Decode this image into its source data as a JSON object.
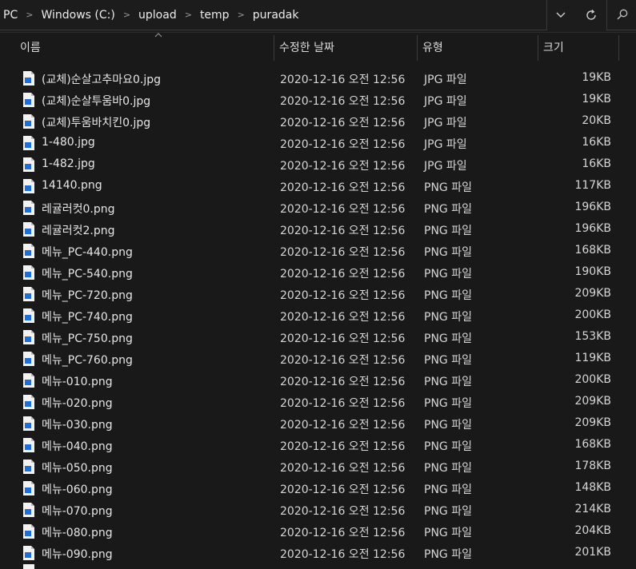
{
  "breadcrumb": [
    "PC",
    "Windows (C:)",
    "upload",
    "temp",
    "puradak"
  ],
  "columns": {
    "name": "이름",
    "date": "수정한 날짜",
    "type": "유형",
    "size": "크기"
  },
  "files": [
    {
      "name": "(교체)순살고추마요0.jpg",
      "date": "2020-12-16 오전 12:56",
      "type": "JPG 파일",
      "size": "19KB"
    },
    {
      "name": "(교체)순살투움바0.jpg",
      "date": "2020-12-16 오전 12:56",
      "type": "JPG 파일",
      "size": "19KB"
    },
    {
      "name": "(교체)투움바치킨0.jpg",
      "date": "2020-12-16 오전 12:56",
      "type": "JPG 파일",
      "size": "20KB"
    },
    {
      "name": "1-480.jpg",
      "date": "2020-12-16 오전 12:56",
      "type": "JPG 파일",
      "size": "16KB"
    },
    {
      "name": "1-482.jpg",
      "date": "2020-12-16 오전 12:56",
      "type": "JPG 파일",
      "size": "16KB"
    },
    {
      "name": "14140.png",
      "date": "2020-12-16 오전 12:56",
      "type": "PNG 파일",
      "size": "117KB"
    },
    {
      "name": "레귤러컷0.png",
      "date": "2020-12-16 오전 12:56",
      "type": "PNG 파일",
      "size": "196KB"
    },
    {
      "name": "레귤러컷2.png",
      "date": "2020-12-16 오전 12:56",
      "type": "PNG 파일",
      "size": "196KB"
    },
    {
      "name": "메뉴_PC-440.png",
      "date": "2020-12-16 오전 12:56",
      "type": "PNG 파일",
      "size": "168KB"
    },
    {
      "name": "메뉴_PC-540.png",
      "date": "2020-12-16 오전 12:56",
      "type": "PNG 파일",
      "size": "190KB"
    },
    {
      "name": "메뉴_PC-720.png",
      "date": "2020-12-16 오전 12:56",
      "type": "PNG 파일",
      "size": "209KB"
    },
    {
      "name": "메뉴_PC-740.png",
      "date": "2020-12-16 오전 12:56",
      "type": "PNG 파일",
      "size": "200KB"
    },
    {
      "name": "메뉴_PC-750.png",
      "date": "2020-12-16 오전 12:56",
      "type": "PNG 파일",
      "size": "153KB"
    },
    {
      "name": "메뉴_PC-760.png",
      "date": "2020-12-16 오전 12:56",
      "type": "PNG 파일",
      "size": "119KB"
    },
    {
      "name": "메뉴-010.png",
      "date": "2020-12-16 오전 12:56",
      "type": "PNG 파일",
      "size": "200KB"
    },
    {
      "name": "메뉴-020.png",
      "date": "2020-12-16 오전 12:56",
      "type": "PNG 파일",
      "size": "209KB"
    },
    {
      "name": "메뉴-030.png",
      "date": "2020-12-16 오전 12:56",
      "type": "PNG 파일",
      "size": "209KB"
    },
    {
      "name": "메뉴-040.png",
      "date": "2020-12-16 오전 12:56",
      "type": "PNG 파일",
      "size": "168KB"
    },
    {
      "name": "메뉴-050.png",
      "date": "2020-12-16 오전 12:56",
      "type": "PNG 파일",
      "size": "178KB"
    },
    {
      "name": "메뉴-060.png",
      "date": "2020-12-16 오전 12:56",
      "type": "PNG 파일",
      "size": "148KB"
    },
    {
      "name": "메뉴-070.png",
      "date": "2020-12-16 오전 12:56",
      "type": "PNG 파일",
      "size": "214KB"
    },
    {
      "name": "메뉴-080.png",
      "date": "2020-12-16 오전 12:56",
      "type": "PNG 파일",
      "size": "204KB"
    },
    {
      "name": "메뉴-090.png",
      "date": "2020-12-16 오전 12:56",
      "type": "PNG 파일",
      "size": "201KB"
    }
  ],
  "icons": {
    "file": "image-file-icon",
    "sort": "sort-up-icon",
    "chevron": "chevron-right-icon",
    "dropdown": "chevron-down-icon",
    "refresh": "refresh-icon",
    "search": "search-icon"
  },
  "colors": {
    "background": "#191919",
    "text": "#e6e6e6",
    "icon_accent": "#1e6fd9"
  }
}
